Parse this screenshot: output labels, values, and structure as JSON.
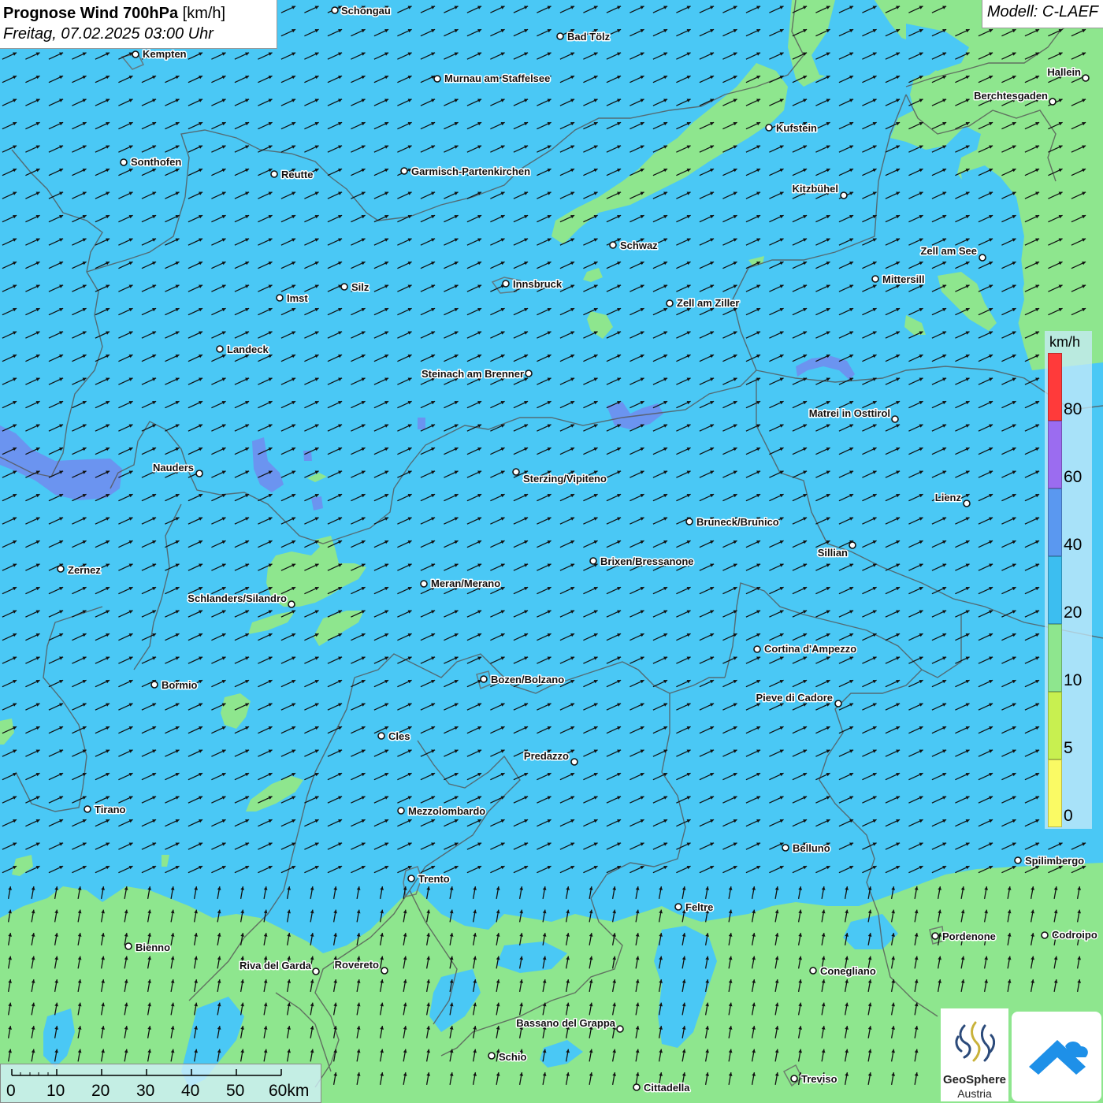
{
  "title": {
    "main": "Prognose Wind 700hPa",
    "unit": "[km/h]",
    "datetime": "Freitag, 07.02.2025 03:00 Uhr"
  },
  "model": "Modell: C-LAEF",
  "legend": {
    "unit": "km/h",
    "labels": [
      "80",
      "60",
      "40",
      "20",
      "10",
      "5",
      "0"
    ],
    "colors": [
      "#ff3a3a",
      "#9b6cf0",
      "#5a98f0",
      "#3cbef0",
      "#8ee68e",
      "#c8f050",
      "#fafa64"
    ]
  },
  "scalebar": {
    "labels": [
      "0",
      "10",
      "20",
      "30",
      "40",
      "50",
      "60km"
    ]
  },
  "cities": [
    {
      "name": "Schongau"
    },
    {
      "name": "Bad Tölz"
    },
    {
      "name": "Kempten"
    },
    {
      "name": "Murnau am Staffelsee"
    },
    {
      "name": "Hallein"
    },
    {
      "name": "Berchtesgaden"
    },
    {
      "name": "Kufstein"
    },
    {
      "name": "Sonthofen"
    },
    {
      "name": "Reutte"
    },
    {
      "name": "Garmisch-Partenkirchen"
    },
    {
      "name": "Kitzbühel"
    },
    {
      "name": "Schwaz"
    },
    {
      "name": "Zell am See"
    },
    {
      "name": "Mittersill"
    },
    {
      "name": "Innsbruck"
    },
    {
      "name": "Silz"
    },
    {
      "name": "Imst"
    },
    {
      "name": "Zell am Ziller"
    },
    {
      "name": "Landeck"
    },
    {
      "name": "Steinach am Brenner"
    },
    {
      "name": "Matrei in Osttirol"
    },
    {
      "name": "Nauders"
    },
    {
      "name": "Sterzing/Vipiteno"
    },
    {
      "name": "Lienz"
    },
    {
      "name": "Bruneck/Brunico"
    },
    {
      "name": "Sillian"
    },
    {
      "name": "Zernez"
    },
    {
      "name": "Brixen/Bressanone"
    },
    {
      "name": "Meran/Merano"
    },
    {
      "name": "Schlanders/Silandro"
    },
    {
      "name": "Cortina d'Ampezzo"
    },
    {
      "name": "Bozen/Bolzano"
    },
    {
      "name": "Bormio"
    },
    {
      "name": "Pieve di Cadore"
    },
    {
      "name": "Cles"
    },
    {
      "name": "Predazzo"
    },
    {
      "name": "Tirano"
    },
    {
      "name": "Mezzolombardo"
    },
    {
      "name": "Belluno"
    },
    {
      "name": "Spilimbergo"
    },
    {
      "name": "Trento"
    },
    {
      "name": "Feltre"
    },
    {
      "name": "Pordenone"
    },
    {
      "name": "Codroipo"
    },
    {
      "name": "Bienno"
    },
    {
      "name": "Riva del Garda"
    },
    {
      "name": "Rovereto"
    },
    {
      "name": "Conegliano"
    },
    {
      "name": "Bassano del Grappa"
    },
    {
      "name": "Schio"
    },
    {
      "name": "Treviso"
    },
    {
      "name": "Cittadella"
    }
  ],
  "logos": {
    "geosphere_line1": "GeoSphere",
    "geosphere_line2": "Austria"
  }
}
